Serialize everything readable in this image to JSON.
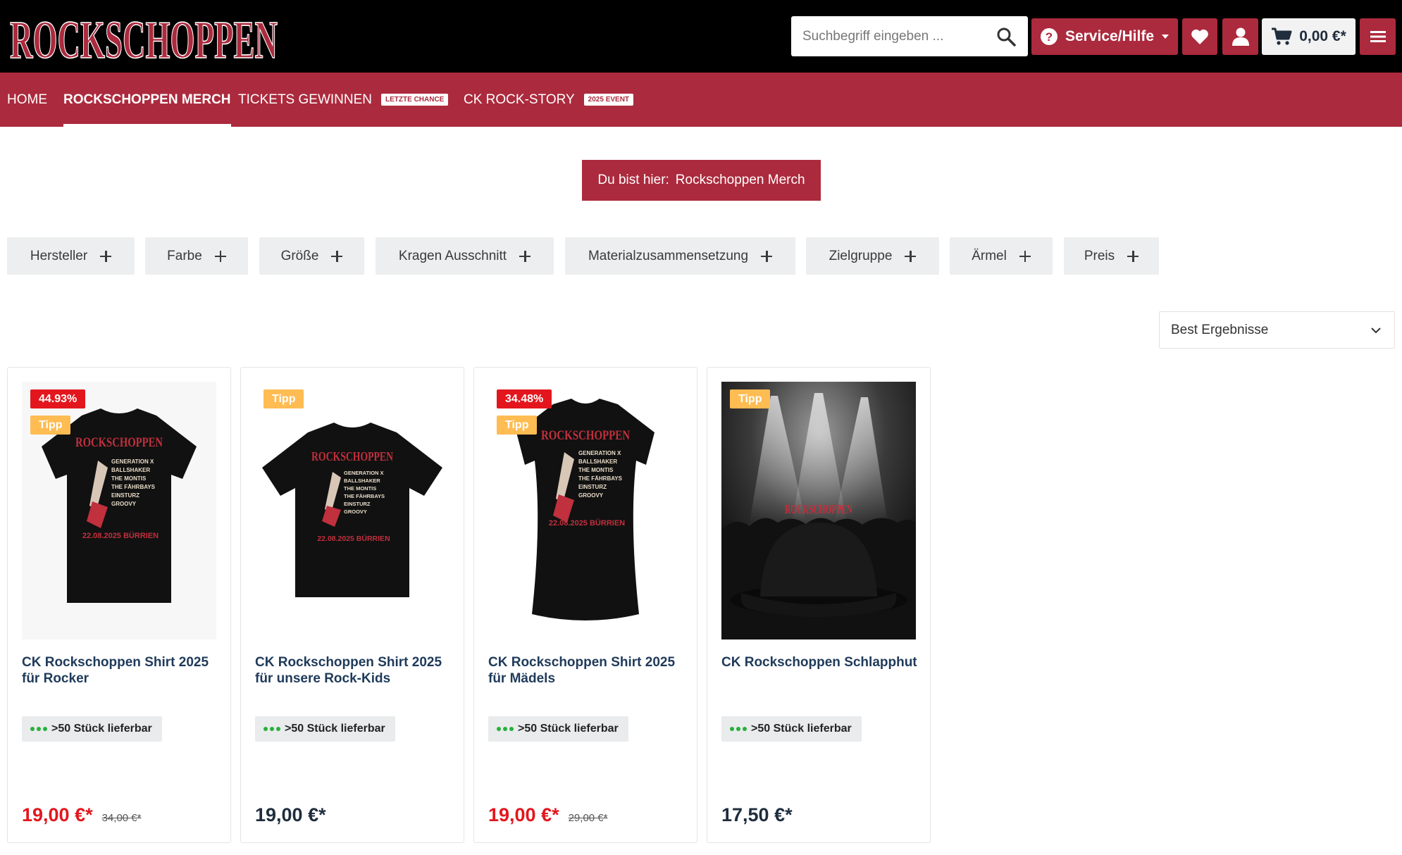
{
  "header": {
    "logo_text": "ROCKSCHOPPEN",
    "search": {
      "placeholder": "Suchbegriff eingeben ..."
    },
    "service_label": "Service/Hilfe",
    "cart_total": "0,00 €*"
  },
  "nav": {
    "items": [
      {
        "label": "Home",
        "badge": ""
      },
      {
        "label": "Rockschoppen Merch",
        "badge": ""
      },
      {
        "label": "Tickets gewinnen",
        "badge": "LETZTE CHANCE"
      },
      {
        "label": "CK Rock-Story",
        "badge": "2025 EVENT"
      }
    ]
  },
  "breadcrumb": {
    "prefix": "Du bist hier:",
    "current": "Rockschoppen Merch"
  },
  "filters": [
    "Hersteller",
    "Farbe",
    "Größe",
    "Kragen Ausschnitt",
    "Materialzusammensetzung",
    "Zielgruppe",
    "Ärmel",
    "Preis"
  ],
  "sort": {
    "selected": "Best Ergebnisse"
  },
  "products": [
    {
      "name": "CK Rockschoppen Shirt 2025 für Rocker",
      "discount": "44.93%",
      "tip": "Tipp",
      "stock": ">50 Stück lieferbar",
      "price": "19,00 €*",
      "old_price": "34,00 €*",
      "image_text": "ROCKSCHOPPEN",
      "lineup": [
        "GENERATION X",
        "BALLSHAKER",
        "THE MONTIS",
        "THE FÄHRBAYS",
        "EINSTURZ",
        "GROOVY"
      ],
      "date": "22.08.2025 BÜRRIEN"
    },
    {
      "name": "CK Rockschoppen Shirt 2025 für unsere Rock-Kids",
      "discount": "",
      "tip": "Tipp",
      "stock": ">50 Stück lieferbar",
      "price": "19,00 €*",
      "old_price": "",
      "image_text": "ROCKSCHOPPEN",
      "lineup": [
        "GENERATION X",
        "BALLSHAKER",
        "THE MONTIS",
        "THE FÄHRBAYS",
        "EINSTURZ",
        "GROOVY"
      ],
      "date": "22.08.2025 BÜRRIEN"
    },
    {
      "name": "CK Rockschoppen Shirt 2025 für Mädels",
      "discount": "34.48%",
      "tip": "Tipp",
      "stock": ">50 Stück lieferbar",
      "price": "19,00 €*",
      "old_price": "29,00 €*",
      "image_text": "ROCKSCHOPPEN",
      "lineup": [
        "GENERATION X",
        "BALLSHAKER",
        "THE MONTIS",
        "THE FÄHRBAYS",
        "EINSTURZ",
        "GROOVY"
      ],
      "date": "22.08.2025 BÜRRIEN"
    },
    {
      "name": "CK Rockschoppen Schlapphut",
      "discount": "",
      "tip": "Tipp",
      "stock": ">50 Stück lieferbar",
      "price": "17,50 €*",
      "old_price": "",
      "image_text": "ROCKSCHOPPEN"
    }
  ],
  "colors": {
    "brand": "#ac2a3d",
    "sale": "#e3161e",
    "tip": "#ffbc53",
    "stock_dot": "#27b03a"
  }
}
